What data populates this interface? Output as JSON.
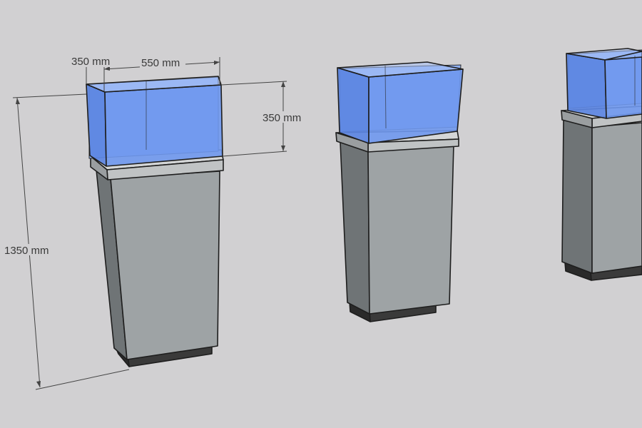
{
  "dimensions": {
    "depth": "350 mm",
    "width": "550 mm",
    "glass_height": "350 mm",
    "total_height": "1350 mm"
  },
  "colors": {
    "background": "#d1d0d2",
    "glass_front": "#6f98ee",
    "glass_side": "#5c86e2",
    "glass_back": "#8fb0f2",
    "cabinet_front": "#9ea3a5",
    "cabinet_side": "#6f7476",
    "ledge": "#c8cbcc",
    "base": "#3a3a3a"
  }
}
